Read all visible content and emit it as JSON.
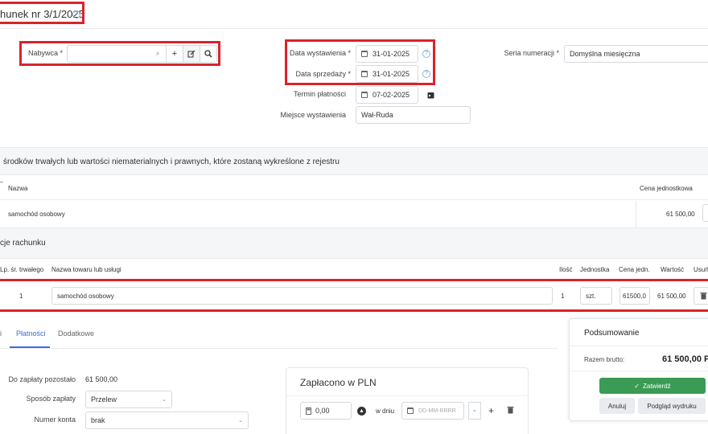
{
  "header": {
    "title": "hunek nr 3/1/2025"
  },
  "buyer": {
    "label": "Nabywca *",
    "value": ""
  },
  "dates": {
    "issue_label": "Data wystawienia *",
    "issue_value": "31-01-2025",
    "sale_label": "Data sprzedaży *",
    "sale_value": "31-01-2025",
    "due_label": "Termin płatności",
    "due_value": "07-02-2025",
    "place_label": "Miejsce wystawienia",
    "place_value": "Wał-Ruda"
  },
  "numbering": {
    "label": "Seria numeracji *",
    "value": "Domyślna miesięczna"
  },
  "assets_section": {
    "title": "środków trwałych lub wartości niematerialnych i prawnych, które zostaną wykreślone z rejestru",
    "col_name": "Nazwa",
    "col_price": "Cena jednostkowa",
    "row_name": "samochód osobowy",
    "row_price": "61 500,00"
  },
  "items_section": {
    "title": "cje rachunku",
    "headers": {
      "lp": "Lp. śr. trwałego",
      "name": "Nazwa towaru lub usługi",
      "qty": "Ilość",
      "unit": "Jednostka",
      "unit_price": "Cena jedn.",
      "value": "Wartość",
      "remove": "Usuń"
    },
    "row": {
      "lp": "1",
      "name": "samochód osobowy",
      "qty": "1",
      "unit": "szt.",
      "unit_price": "61500,0",
      "value": "61 500,00"
    }
  },
  "tabs": {
    "first": "i",
    "payments": "Płatności",
    "extra": "Dodatkowe"
  },
  "payment": {
    "remaining_label": "Do zapłaty pozostało",
    "remaining_value": "61 500,00",
    "method_label": "Sposób zapłaty",
    "method_value": "Przelew",
    "account_label": "Numer konta",
    "account_value": "brak"
  },
  "paid_card": {
    "title": "Zapłacono w PLN",
    "amount": "0,00",
    "date_label": "w dniu",
    "date_placeholder": "DD-MM-RRRR"
  },
  "summary": {
    "title": "Podsumowanie",
    "gross_label": "Razem brutto:",
    "gross_value": "61 500,00 P",
    "approve": "Zatwierdź",
    "cancel": "Anuluj",
    "preview": "Podgląd wydruku"
  },
  "colors": {
    "accent": "#3b6fd6",
    "success": "#3a9b54",
    "highlight": "#d9232d"
  }
}
